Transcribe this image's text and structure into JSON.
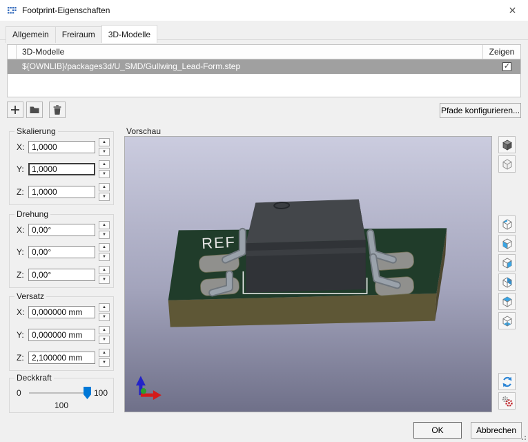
{
  "window": {
    "title": "Footprint-Eigenschaften"
  },
  "icons": {
    "close": "✕",
    "check": "✓",
    "spin_up": "▲",
    "spin_down": "▼"
  },
  "tabs": {
    "allgemein": "Allgemein",
    "freiraum": "Freiraum",
    "modelle": "3D-Modelle"
  },
  "model_table": {
    "col_model": "3D-Modelle",
    "col_show": "Zeigen",
    "rows": [
      {
        "path": "${OWNLIB}/packages3d/U_SMD/Gullwing_Lead-Form.step",
        "show": true
      }
    ]
  },
  "toolbar": {
    "configure_paths": "Pfade konfigurieren..."
  },
  "scale": {
    "title": "Skalierung",
    "x_label": "X:",
    "y_label": "Y:",
    "z_label": "Z:",
    "x": "1,0000",
    "y": "1,0000",
    "z": "1,0000"
  },
  "rotation": {
    "title": "Drehung",
    "x_label": "X:",
    "y_label": "Y:",
    "z_label": "Z:",
    "x": "0,00°",
    "y": "0,00°",
    "z": "0,00°"
  },
  "offset": {
    "title": "Versatz",
    "x_label": "X:",
    "y_label": "Y:",
    "z_label": "Z:",
    "x": "0,000000 mm",
    "y": "0,000000 mm",
    "z": "2,100000 mm"
  },
  "opacity": {
    "title": "Deckkraft",
    "min": "0",
    "max": "100",
    "value": "100"
  },
  "preview": {
    "label": "Vorschau",
    "silkscreen": "REF"
  },
  "actions": {
    "ok": "OK",
    "cancel": "Abbrechen"
  },
  "colors": {
    "accent_blue": "#39a5e5",
    "selection_gray": "#a0a0a0",
    "board_green": "#203c2a",
    "thumb_blue": "#0078d7"
  }
}
